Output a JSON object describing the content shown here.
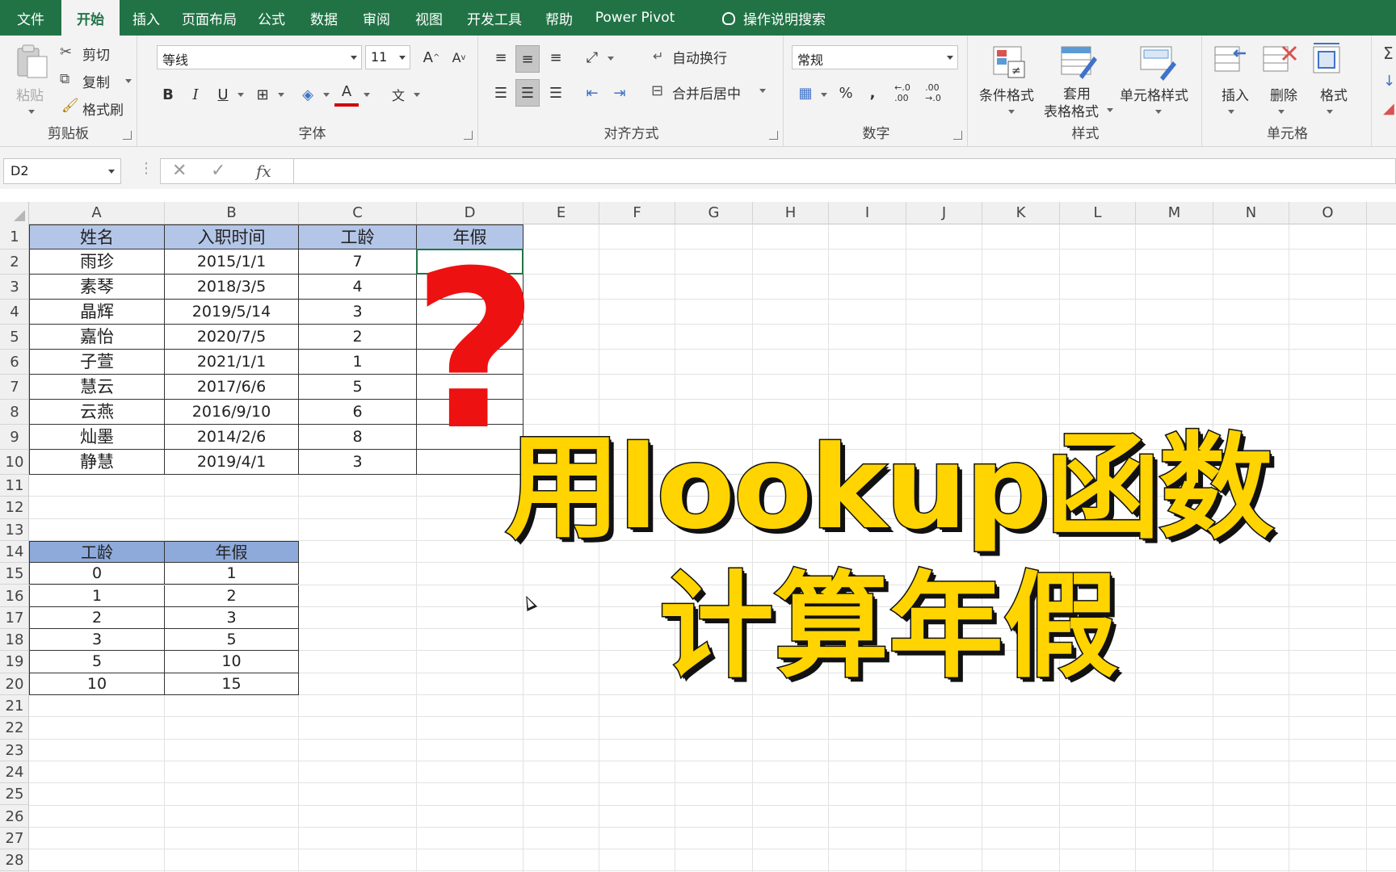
{
  "tabs": [
    "文件",
    "开始",
    "插入",
    "页面布局",
    "公式",
    "数据",
    "审阅",
    "视图",
    "开发工具",
    "帮助",
    "Power Pivot",
    "操作说明搜索"
  ],
  "active_tab": "开始",
  "ribbon": {
    "clipboard": {
      "label": "剪贴板",
      "paste": "粘贴",
      "cut": "剪切",
      "copy": "复制",
      "format_painter": "格式刷"
    },
    "font": {
      "label": "字体",
      "font_name": "等线",
      "font_size": "11",
      "bold": "B",
      "italic": "I",
      "underline": "U",
      "font_color": "A",
      "phonetic": "文"
    },
    "alignment": {
      "label": "对齐方式",
      "wrap_text": "自动换行",
      "merge_center": "合并后居中"
    },
    "number": {
      "label": "数字",
      "format": "常规",
      "percent": "%",
      "comma": ","
    },
    "styles": {
      "label": "样式",
      "conditional": "条件格式",
      "table_format": "套用\n表格格式",
      "table_format_1": "套用",
      "table_format_2": "表格格式",
      "cell_styles": "单元格样式"
    },
    "cells": {
      "label": "单元格",
      "insert": "插入",
      "delete": "删除",
      "format": "格式"
    }
  },
  "formula_bar": {
    "name_box": "D2",
    "fx": "fx",
    "formula": ""
  },
  "columns": [
    "A",
    "B",
    "C",
    "D",
    "E",
    "F",
    "G",
    "H",
    "I",
    "J",
    "K",
    "L",
    "M",
    "N",
    "O"
  ],
  "rows": [
    "1",
    "2",
    "3",
    "4",
    "5",
    "6",
    "7",
    "8",
    "9",
    "10",
    "11",
    "12",
    "13",
    "14",
    "15",
    "16",
    "17",
    "18",
    "19",
    "20",
    "21",
    "22",
    "23",
    "24",
    "25",
    "26",
    "27",
    "28"
  ],
  "table1": {
    "headers": [
      "姓名",
      "入职时间",
      "工龄",
      "年假"
    ],
    "rows": [
      [
        "雨珍",
        "2015/1/1",
        "7",
        ""
      ],
      [
        "素琴",
        "2018/3/5",
        "4",
        ""
      ],
      [
        "晶辉",
        "2019/5/14",
        "3",
        ""
      ],
      [
        "嘉怡",
        "2020/7/5",
        "2",
        ""
      ],
      [
        "子萱",
        "2021/1/1",
        "1",
        ""
      ],
      [
        "慧云",
        "2017/6/6",
        "5",
        ""
      ],
      [
        "云燕",
        "2016/9/10",
        "6",
        ""
      ],
      [
        "灿墨",
        "2014/2/6",
        "8",
        ""
      ],
      [
        "静慧",
        "2019/4/1",
        "3",
        ""
      ]
    ]
  },
  "table2": {
    "headers": [
      "工龄",
      "年假"
    ],
    "rows": [
      [
        "0",
        "1"
      ],
      [
        "1",
        "2"
      ],
      [
        "2",
        "3"
      ],
      [
        "3",
        "5"
      ],
      [
        "5",
        "10"
      ],
      [
        "10",
        "15"
      ]
    ]
  },
  "overlay": {
    "question_mark": "?",
    "line1": "用lookup函数",
    "line2": "计算年假"
  },
  "colors": {
    "excel_green": "#217346",
    "header_fill": "#b4c6e7",
    "header_fill_dark": "#8eaadb",
    "title_yellow": "#ffd400",
    "question_red": "#ee1111"
  }
}
